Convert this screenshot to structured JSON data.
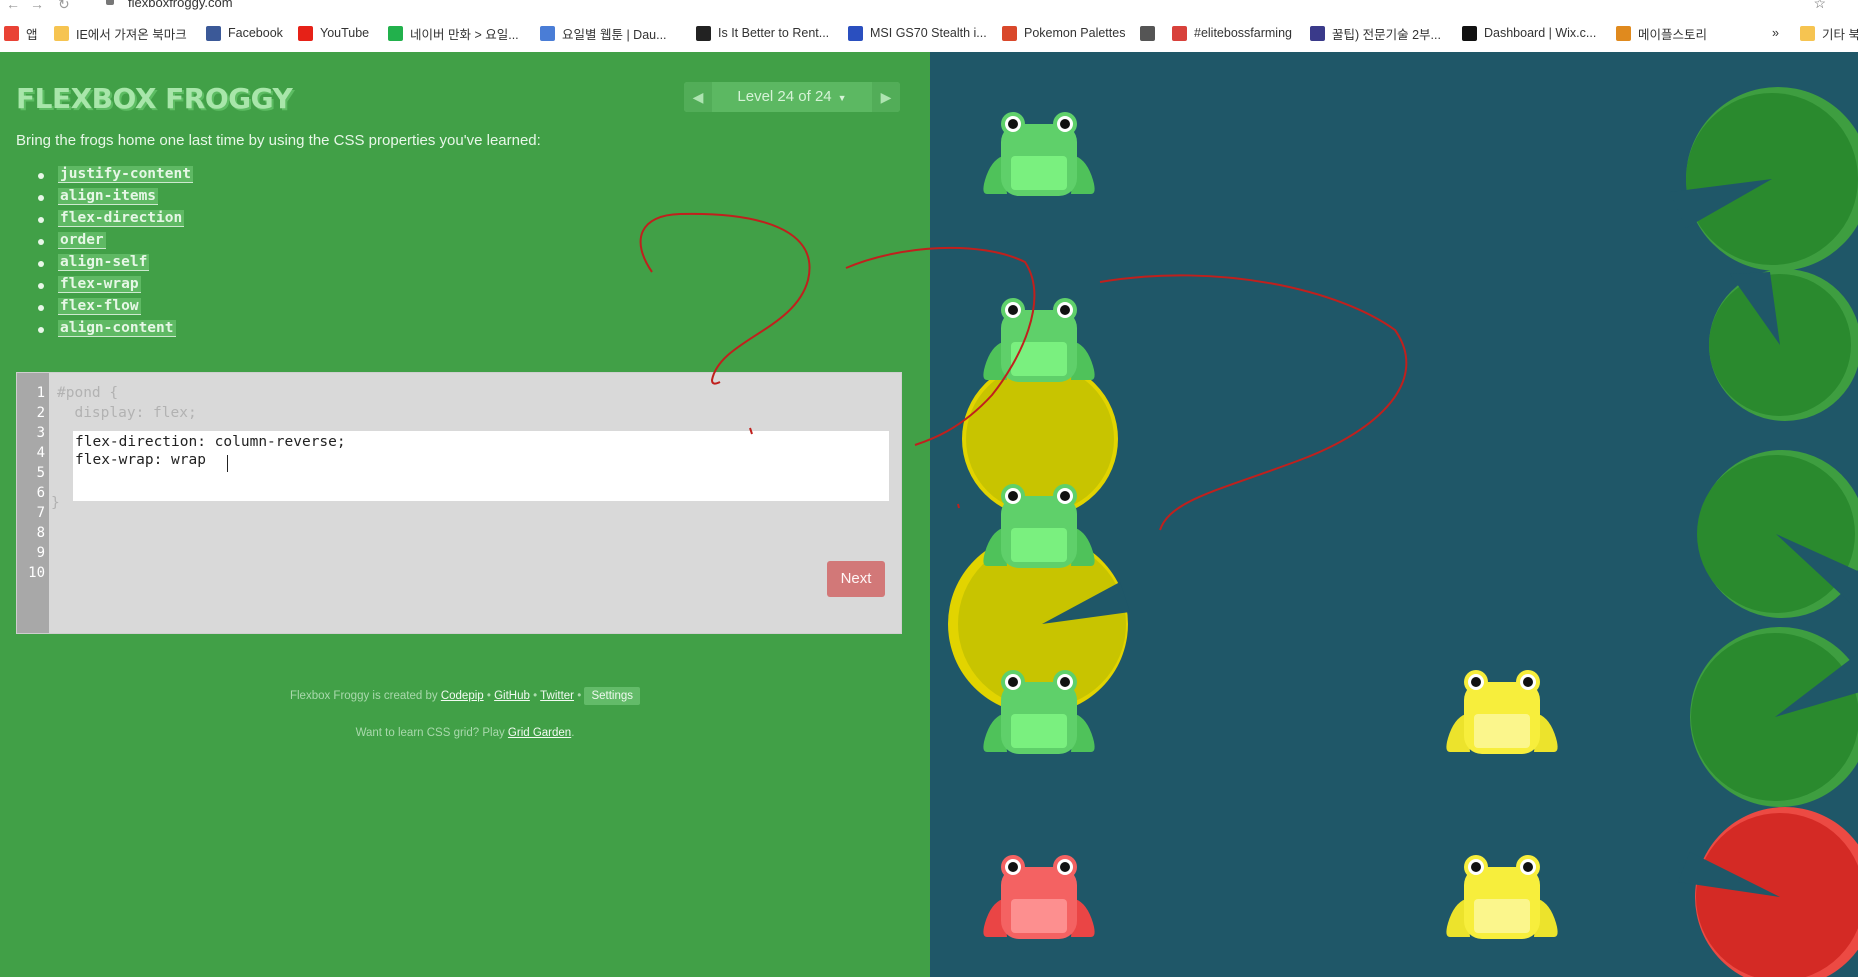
{
  "browser": {
    "url": "flexboxfroggy.com",
    "bookmarks": [
      {
        "label": "앱",
        "color": "#e94235"
      },
      {
        "label": "IE에서 가져온 북마크",
        "color": "#f6c451"
      },
      {
        "label": "Facebook",
        "color": "#3b5998"
      },
      {
        "label": "YouTube",
        "color": "#e62117"
      },
      {
        "label": "네이버 만화 > 요일...",
        "color": "#22b14c"
      },
      {
        "label": "요일별 웹툰 | Dau...",
        "color": "#4a7dd6"
      },
      {
        "label": "Is It Better to Rent...",
        "color": "#222222"
      },
      {
        "label": "MSI GS70 Stealth i...",
        "color": "#2a4fbf"
      },
      {
        "label": "Pokemon Palettes",
        "color": "#d9482b"
      },
      {
        "label": "",
        "color": "#555555"
      },
      {
        "label": "#elitebossfarming",
        "color": "#d8413b"
      },
      {
        "label": "꿀팁) 전문기술 2부...",
        "color": "#3a3a8a"
      },
      {
        "label": "Dashboard | Wix.c...",
        "color": "#111111"
      },
      {
        "label": "메이플스토리",
        "color": "#e08a1e"
      },
      {
        "label": "기타 북",
        "color": "#f6c451"
      }
    ],
    "more_label": "»"
  },
  "game": {
    "title": "FLEXBOX FROGGY",
    "level_label": "Level 24 of 24",
    "prev_arrow": "◀",
    "next_arrow": "▶",
    "dropdown_caret": "▼",
    "instructions": "Bring the frogs home one last time by using the CSS properties you've learned:",
    "properties": [
      "justify-content",
      "align-items",
      "flex-direction",
      "order",
      "align-self",
      "flex-wrap",
      "flex-flow",
      "align-content"
    ]
  },
  "editor": {
    "line_numbers": [
      "1",
      "2",
      "3",
      "4",
      "5",
      "6",
      "7",
      "8",
      "9",
      "10"
    ],
    "line1": "#pond {",
    "line2": "  display: flex;",
    "input_lines": [
      "flex-direction: column-reverse;",
      "flex-wrap: wrap "
    ],
    "closing": "}",
    "next_label": "Next"
  },
  "footer": {
    "credit_prefix": "Flexbox Froggy is created by",
    "codepip": "Codepip",
    "github": "GitHub",
    "twitter": "Twitter",
    "separator": "•",
    "settings": "Settings",
    "learn_prefix": "Want to learn CSS grid? Play",
    "grid_garden": "Grid Garden",
    "learn_suffix": "."
  },
  "pond": {
    "colors": {
      "water": "#1f5768",
      "green": "#4fc25a",
      "yellow": "#f4e83b",
      "red": "#f05454",
      "green_lily": "#2a8a2e",
      "yellow_lily": "#c8c400",
      "red_lily": "#d42a25"
    },
    "frogs": [
      "green",
      "green",
      "green",
      "green",
      "red",
      "yellow",
      "yellow"
    ],
    "lilypads": [
      "green",
      "green",
      "green",
      "green",
      "red",
      "yellow",
      "yellow"
    ]
  }
}
